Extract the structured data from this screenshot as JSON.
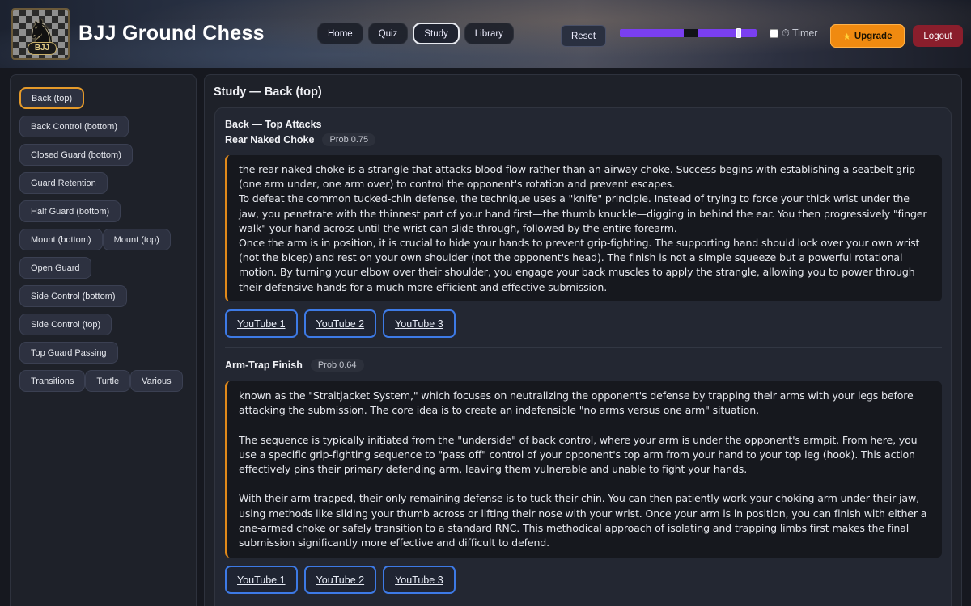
{
  "app": {
    "title": "BJJ Ground Chess",
    "logo_icon": "chess-knight-icon",
    "logo_text": "BJJ"
  },
  "nav": {
    "tabs": [
      "Home",
      "Quiz",
      "Study",
      "Library"
    ],
    "active_tab": "Study"
  },
  "toolbar": {
    "reset_label": "Reset",
    "timer_label": "⏱ Timer",
    "timer_checked": false,
    "upgrade_label": "Upgrade",
    "upgrade_icon": "star-icon",
    "logout_label": "Logout",
    "slider_level": 0.87
  },
  "colors": {
    "accent_orange": "#e59a2a",
    "slider_purple": "#7a3ff0",
    "link_blue": "#3d7ae6",
    "logout_red": "#8a1e2c"
  },
  "sidebar": {
    "rows": [
      [
        "Back (top)"
      ],
      [
        "Back Control (bottom)"
      ],
      [
        "Closed Guard (bottom)"
      ],
      [
        "Guard Retention"
      ],
      [
        "Half Guard (bottom)"
      ],
      [
        "Mount (bottom)",
        "Mount (top)"
      ],
      [
        "Open Guard"
      ],
      [
        "Side Control (bottom)"
      ],
      [
        "Side Control (top)"
      ],
      [
        "Top Guard Passing"
      ],
      [
        "Transitions",
        "Turtle",
        "Various"
      ]
    ],
    "active": "Back (top)"
  },
  "main": {
    "title": "Study — Back (top)",
    "section_title": "Back — Top Attacks",
    "techniques": [
      {
        "name": "Rear Naked Choke",
        "prob": "Prob 0.75",
        "description": "the rear naked choke is a strangle that attacks blood flow rather than an airway choke. Success begins with establishing a seatbelt grip (one arm under, one arm over) to control the opponent's rotation and prevent escapes.\nTo defeat the common tucked-chin defense, the technique uses a \"knife\" principle. Instead of trying to force your thick wrist under the jaw, you penetrate with the thinnest part of your hand first—the thumb knuckle—digging in behind the ear. You then progressively \"finger walk\" your hand across until the wrist can slide through, followed by the entire forearm.\nOnce the arm is in position, it is crucial to hide your hands to prevent grip-fighting. The supporting hand should lock over your own wrist (not the bicep) and rest on your own shoulder (not the opponent's head). The finish is not a simple squeeze but a powerful rotational motion. By turning your elbow over their shoulder, you engage your back muscles to apply the strangle, allowing you to power through their defensive hands for a much more efficient and effective submission.",
        "videos": [
          "YouTube 1",
          "YouTube 2",
          "YouTube 3"
        ]
      },
      {
        "name": "Arm-Trap Finish",
        "prob": "Prob 0.64",
        "description": "known as the \"Straitjacket System,\" which focuses on neutralizing the opponent's defense by trapping their arms with your legs before attacking the submission. The core idea is to create an indefensible \"no arms versus one arm\" situation.\n\nThe sequence is typically initiated from the \"underside\" of back control, where your arm is under the opponent's armpit. From here, you use a specific grip-fighting sequence to \"pass off\" control of your opponent's top arm from your hand to your top leg (hook). This action effectively pins their primary defending arm, leaving them vulnerable and unable to fight your hands.\n\nWith their arm trapped, their only remaining defense is to tuck their chin. You can then patiently work your choking arm under their jaw, using methods like sliding your thumb across or lifting their nose with your wrist. Once your arm is in position, you can finish with either a one-armed choke or safely transition to a standard RNC. This methodical approach of isolating and trapping limbs first makes the final submission significantly more effective and difficult to defend.",
        "videos": [
          "YouTube 1",
          "YouTube 2",
          "YouTube 3"
        ]
      }
    ]
  }
}
